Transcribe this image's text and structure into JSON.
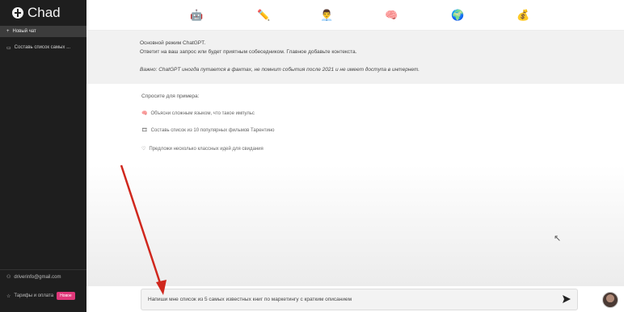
{
  "sidebar": {
    "logo_text": "Chad",
    "new_chat_label": "Новый чат",
    "chats": [
      {
        "label": "Составь список самых ..."
      }
    ],
    "account_email": "driverinfo@gmail.com",
    "plans_label": "Тарифы и оплата",
    "new_badge": "Новое"
  },
  "modes": [
    {
      "icon": "🤖",
      "name": "robot-mode-icon"
    },
    {
      "icon": "✏️",
      "name": "pencil-mode-icon"
    },
    {
      "icon": "👨‍💼",
      "name": "person-mode-icon"
    },
    {
      "icon": "🧠",
      "name": "brain-mode-icon"
    },
    {
      "icon": "🌍",
      "name": "globe-mode-icon"
    },
    {
      "icon": "💰",
      "name": "money-bag-mode-icon"
    }
  ],
  "info": {
    "mode_title": "Основной режим ChatGPT.",
    "mode_desc": "Ответит на ваш запрос или будет приятным собеседником. Главное добавьте контекста.",
    "warning": "Важно: ChatGPT иногда путается в фактах, не помнит события после 2021 и не имеет доступа в интернет."
  },
  "examples": {
    "heading": "Спросите для примера:",
    "items": [
      {
        "icon": "🧠",
        "text": "Объясни сложным языком, что такое импульс"
      },
      {
        "icon": "🎞",
        "text": "Составь список из 10 популярных фильмов Тарентино"
      },
      {
        "icon": "♡",
        "text": "Предложи несколько классных идей для свидания"
      }
    ]
  },
  "input": {
    "value": "Напиши мне список из 5 самых известных книг по маркетингу с кратким описанием"
  },
  "colors": {
    "sidebar_bg": "#1e1e1e",
    "info_bg": "#f1f1f1",
    "badge": "#e0387a",
    "arrow": "#d0271d"
  }
}
